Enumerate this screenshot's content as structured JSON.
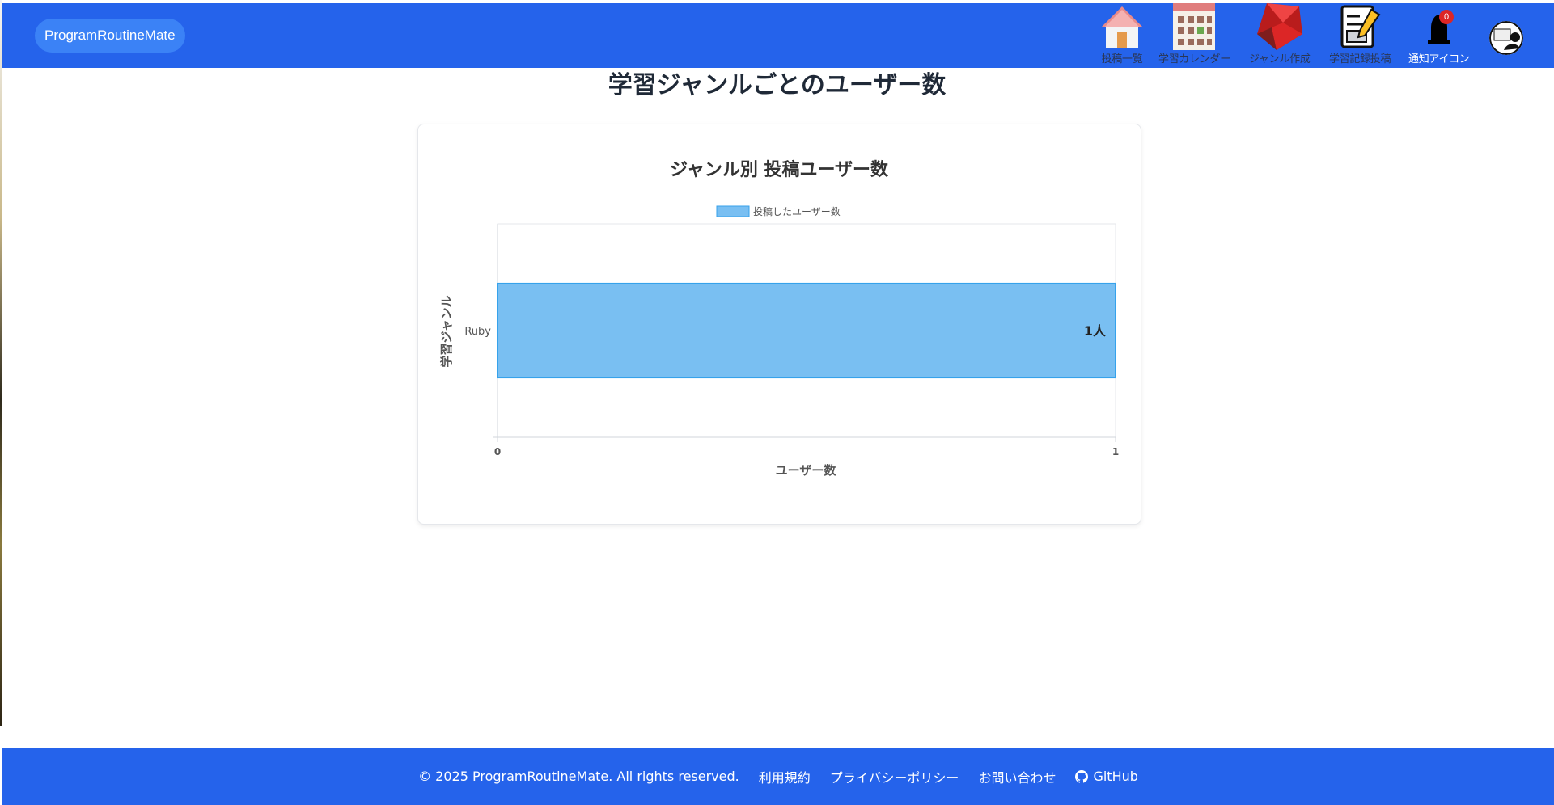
{
  "app": {
    "brand": "ProgramRoutineMate"
  },
  "nav": {
    "items": [
      {
        "label": "投稿一覧",
        "icon": "house-icon"
      },
      {
        "label": "学習カレンダー",
        "icon": "calendar-icon"
      },
      {
        "label": "ジャンル作成",
        "icon": "ruby-gem-icon"
      },
      {
        "label": "学習記録投稿",
        "icon": "document-pencil-icon"
      },
      {
        "label": "通知アイコン",
        "icon": "bell-icon",
        "badge": "0"
      }
    ],
    "avatar_icon": "user-avatar-icon"
  },
  "main": {
    "title": "学習ジャンルごとのユーザー数"
  },
  "chart_data": {
    "type": "bar",
    "orientation": "horizontal",
    "title": "ジャンル別 投稿ユーザー数",
    "categories": [
      "Ruby"
    ],
    "series": [
      {
        "name": "投稿したユーザー数",
        "values": [
          1
        ],
        "data_labels": [
          "1人"
        ]
      }
    ],
    "xlabel": "ユーザー数",
    "ylabel": "学習ジャンル",
    "xlim": [
      0,
      1
    ],
    "xticks": [
      "0",
      "1"
    ],
    "legend_position": "top",
    "grid": true,
    "bar_color": "#79bff2",
    "bar_border_color": "#36a2eb"
  },
  "footer": {
    "copyright": "© 2025 ProgramRoutineMate. All rights reserved.",
    "terms": "利用規約",
    "privacy": "プライバシーポリシー",
    "contact": "お問い合わせ",
    "github": "GitHub"
  },
  "colors": {
    "header": "#2563eb",
    "brand_pill": "#3b82f6",
    "badge": "#dc2626"
  }
}
